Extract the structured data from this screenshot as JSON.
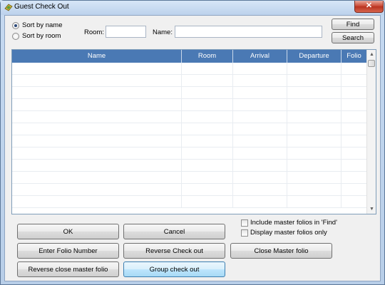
{
  "window": {
    "title": "Guest Check Out",
    "close_glyph": "✕"
  },
  "sort": {
    "options": [
      {
        "label": "Sort by name",
        "selected": true
      },
      {
        "label": "Sort by room",
        "selected": false
      }
    ]
  },
  "filters": {
    "room_label": "Room:",
    "room_value": "",
    "name_label": "Name:",
    "name_value": ""
  },
  "top_buttons": {
    "find": "Find",
    "search": "Search"
  },
  "grid": {
    "columns": [
      "Name",
      "Room",
      "Arrival",
      "Departure",
      "Folio"
    ],
    "rows": [],
    "scroll_up": "▲",
    "scroll_down": "▼"
  },
  "options": {
    "include_master_folios": {
      "label": "Include master folios in 'Find'",
      "checked": false
    },
    "display_master_folios": {
      "label": "Display master folios only",
      "checked": false
    }
  },
  "buttons": {
    "ok": "OK",
    "cancel": "Cancel",
    "enter_folio": "Enter Folio Number",
    "reverse_check_out": "Reverse Check out",
    "close_master_folio": "Close Master folio",
    "reverse_close_master_folio": "Reverse close master folio",
    "group_check_out": "Group check out"
  }
}
